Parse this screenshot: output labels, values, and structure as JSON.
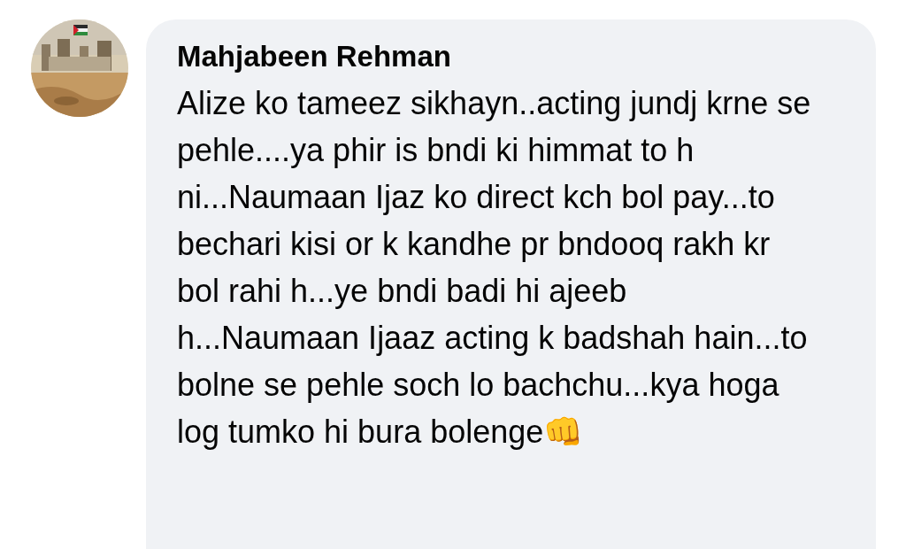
{
  "comment": {
    "author": "Mahjabeen Rehman",
    "text": "Alize ko tameez sikhayn..acting jundj krne se pehle....ya phir is bndi ki himmat to h ni...Naumaan Ijaz ko direct kch bol pay...to bechari kisi or k kandhe pr bndooq rakh kr bol rahi h...ye bndi badi hi ajeeb h...Naumaan Ijaaz acting k badshah hain...to bolne se pehle soch lo bachchu...kya hoga log tumko hi bura bolenge👊"
  }
}
